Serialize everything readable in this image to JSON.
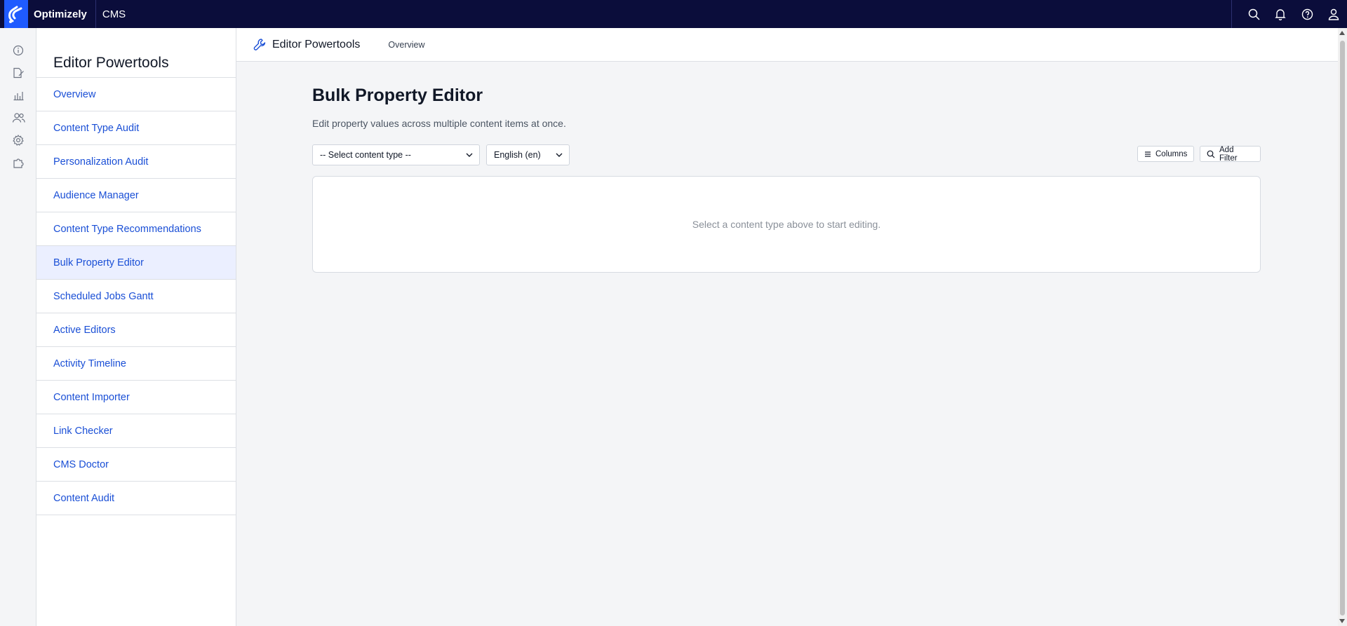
{
  "topbar": {
    "brand": "Optimizely",
    "product": "CMS",
    "icons": [
      "search-icon",
      "bell-icon",
      "help-icon",
      "user-icon"
    ]
  },
  "rail": {
    "icons": [
      "info-icon",
      "edit-icon",
      "reports-icon",
      "users-icon",
      "settings-icon",
      "addons-icon"
    ]
  },
  "nav": {
    "title": "Editor Powertools",
    "items": [
      {
        "label": "Overview"
      },
      {
        "label": "Content Type Audit"
      },
      {
        "label": "Personalization Audit"
      },
      {
        "label": "Audience Manager"
      },
      {
        "label": "Content Type Recommendations"
      },
      {
        "label": "Bulk Property Editor",
        "active": true
      },
      {
        "label": "Scheduled Jobs Gantt"
      },
      {
        "label": "Active Editors"
      },
      {
        "label": "Activity Timeline"
      },
      {
        "label": "Content Importer"
      },
      {
        "label": "Link Checker"
      },
      {
        "label": "CMS Doctor"
      },
      {
        "label": "Content Audit"
      }
    ]
  },
  "header": {
    "title": "Editor Powertools",
    "link": "Overview"
  },
  "main": {
    "title": "Bulk Property Editor",
    "description": "Edit property values across multiple content items at once.",
    "content_type_select": "-- Select content type --",
    "language_select": "English (en)",
    "columns_button": "Columns",
    "add_filter_button": "Add Filter",
    "empty_message": "Select a content type above to start editing."
  },
  "colors": {
    "topbar": "#0b0d3b",
    "brand_blue": "#1f5bff",
    "link": "#1a4fd6",
    "active_bg": "#ebefff"
  }
}
